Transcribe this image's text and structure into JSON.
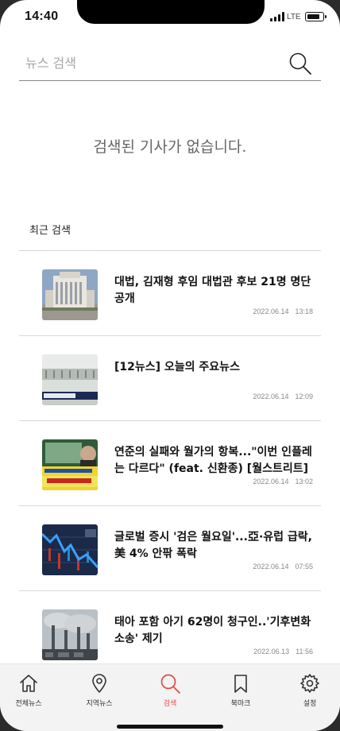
{
  "status_bar": {
    "time": "14:40",
    "network": "LTE"
  },
  "search": {
    "placeholder": "뉴스 검색",
    "value": ""
  },
  "empty_message": "검색된 기사가 없습니다.",
  "recent_section_title": "최근 검색",
  "recent_items": [
    {
      "headline": "대법, 김재형 후임 대법관 후보 21명 명단 공개",
      "date": "2022.06.14",
      "time": "13:18",
      "thumb": "court-building"
    },
    {
      "headline": "[12뉴스] 오늘의 주요뉴스",
      "date": "2022.06.14",
      "time": "12:09",
      "thumb": "broadcast-news"
    },
    {
      "headline": "연준의 실패와 월가의 항복...\"이번 인플레는 다르다\" (feat. 신환종) [월스트리트]",
      "date": "2022.06.14",
      "time": "13:02",
      "thumb": "video-thumbnail"
    },
    {
      "headline": "글로벌 증시 '검은 월요일'...亞·유럽 급락, 美 4% 안팎 폭락",
      "date": "2022.06.14",
      "time": "07:55",
      "thumb": "stock-chart"
    },
    {
      "headline": "태아 포함 아기 62명이 청구인..'기후변화 소송' 제기",
      "date": "2022.06.13",
      "time": "11:56",
      "thumb": "smokestacks"
    }
  ],
  "tabs": [
    {
      "label": "전체뉴스",
      "icon": "home-icon"
    },
    {
      "label": "지역뉴스",
      "icon": "location-pin-icon"
    },
    {
      "label": "검색",
      "icon": "search-icon",
      "active": true
    },
    {
      "label": "북마크",
      "icon": "bookmark-icon"
    },
    {
      "label": "설정",
      "icon": "gear-icon"
    }
  ],
  "colors": {
    "accent": "#e34a48",
    "divider": "#d8d8d8",
    "tabbar_bg": "#f3f3f3"
  }
}
